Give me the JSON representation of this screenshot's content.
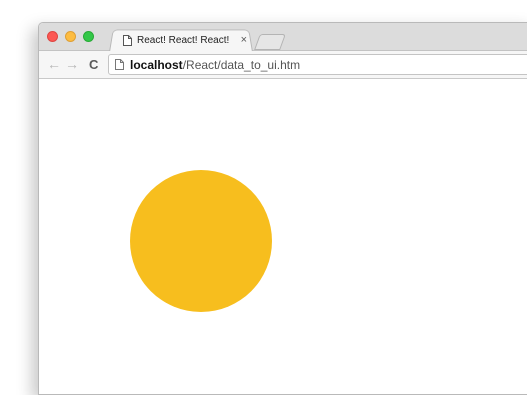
{
  "window": {
    "tab": {
      "title": "React! React! React!",
      "close_glyph": "×",
      "icon": "page-icon"
    },
    "toolbar": {
      "back_glyph": "←",
      "forward_glyph": "→",
      "reload_glyph": "C",
      "address": {
        "host": "localhost",
        "path": "/React/data_to_ui.htm",
        "icon": "page-icon"
      }
    }
  },
  "content": {
    "shape": "circle",
    "fill_color": "#F7BE1E"
  },
  "colors": {
    "close": "#FC5753",
    "minimize": "#FDBC40",
    "maximize": "#33C748"
  }
}
